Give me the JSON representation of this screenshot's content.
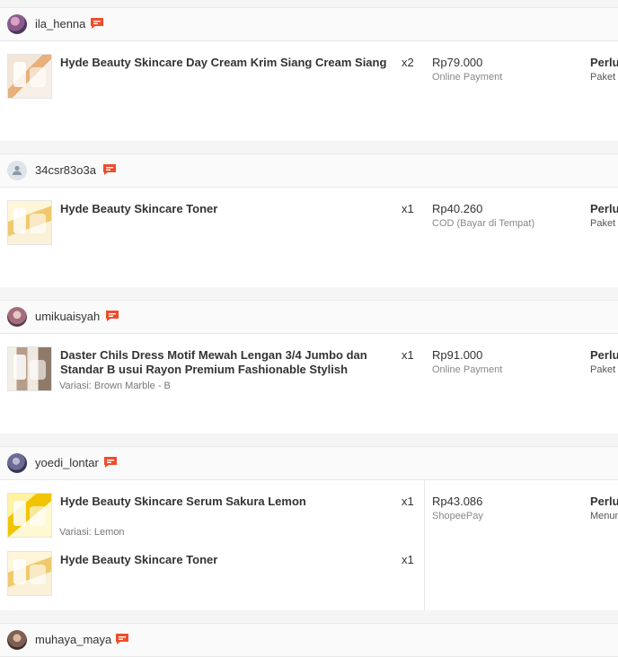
{
  "colors": {
    "chat_icon": "#ee4d2d",
    "divider": "#e8e8e8",
    "header_bg": "#fafafa",
    "gap_bg": "#f5f5f5"
  },
  "orders": [
    {
      "username": "ila_henna",
      "avatar": "photo",
      "price": "Rp79.000",
      "payment": "Online Payment",
      "status": "Perlu",
      "status_sub": "Paket",
      "items": [
        {
          "name": "Hyde Beauty Skincare Day Cream Krim Siang Cream Siang",
          "variant": "",
          "qty": "x2",
          "thumb_label": "Sunscreen"
        }
      ]
    },
    {
      "username": "34csr83o3a",
      "avatar": "default",
      "price": "Rp40.260",
      "payment": "COD (Bayar di Tempat)",
      "status": "Perlu",
      "status_sub": "Paket",
      "items": [
        {
          "name": "Hyde Beauty Skincare Toner",
          "variant": "",
          "qty": "x1"
        }
      ]
    },
    {
      "username": "umikuaisyah",
      "avatar": "photo",
      "price": "Rp91.000",
      "payment": "Online Payment",
      "status": "Perlu",
      "status_sub": "Paket",
      "items": [
        {
          "name": "Daster Chils Dress Motif Mewah Lengan 3/4 Jumbo dan Standar B usui Rayon Premium Fashionable Stylish",
          "variant": "Variasi: Brown Marble - B",
          "qty": "x1"
        }
      ]
    },
    {
      "username": "yoedi_lontar",
      "avatar": "photo",
      "price": "Rp43.086",
      "payment": "ShopeePay",
      "status": "Perlu",
      "status_sub": "Menun",
      "items": [
        {
          "name": "Hyde Beauty Skincare Serum Sakura Lemon",
          "variant": "Variasi: Lemon",
          "qty": "x1"
        },
        {
          "name": "Hyde Beauty Skincare Toner",
          "variant": "",
          "qty": "x1"
        }
      ]
    },
    {
      "username": "muhaya_maya",
      "avatar": "photo"
    }
  ]
}
